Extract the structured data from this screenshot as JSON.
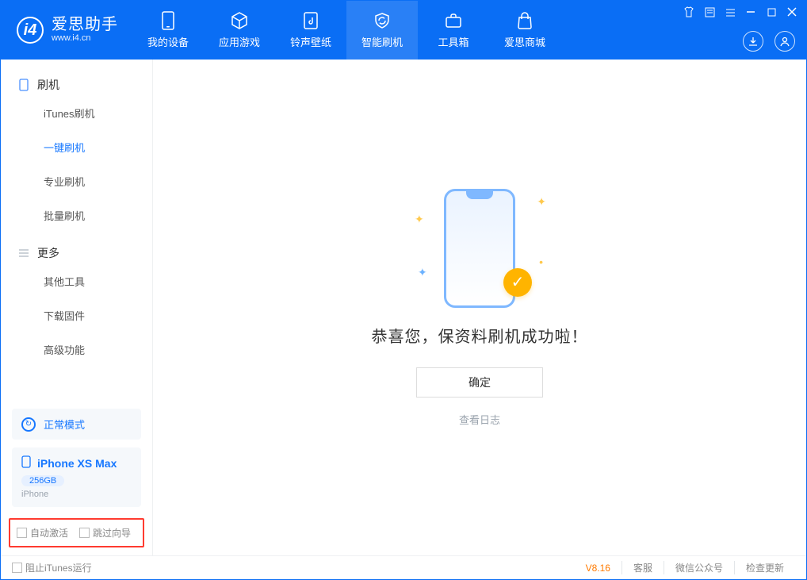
{
  "app": {
    "name_cn": "爱思助手",
    "name_en": "www.i4.cn"
  },
  "nav": {
    "items": [
      {
        "label": "我的设备"
      },
      {
        "label": "应用游戏"
      },
      {
        "label": "铃声壁纸"
      },
      {
        "label": "智能刷机"
      },
      {
        "label": "工具箱"
      },
      {
        "label": "爱思商城"
      }
    ]
  },
  "sidebar": {
    "group1": {
      "title": "刷机"
    },
    "group1_items": [
      {
        "label": "iTunes刷机"
      },
      {
        "label": "一键刷机"
      },
      {
        "label": "专业刷机"
      },
      {
        "label": "批量刷机"
      }
    ],
    "group2": {
      "title": "更多"
    },
    "group2_items": [
      {
        "label": "其他工具"
      },
      {
        "label": "下载固件"
      },
      {
        "label": "高级功能"
      }
    ],
    "mode": {
      "label": "正常模式"
    },
    "device": {
      "name": "iPhone XS Max",
      "storage": "256GB",
      "type": "iPhone"
    },
    "checks": {
      "auto_activate": "自动激活",
      "skip_guide": "跳过向导"
    }
  },
  "main": {
    "success_text": "恭喜您，保资料刷机成功啦！",
    "ok_button": "确定",
    "view_log": "查看日志"
  },
  "footer": {
    "block_itunes": "阻止iTunes运行",
    "version": "V8.16",
    "links": [
      {
        "label": "客服"
      },
      {
        "label": "微信公众号"
      },
      {
        "label": "检查更新"
      }
    ]
  }
}
